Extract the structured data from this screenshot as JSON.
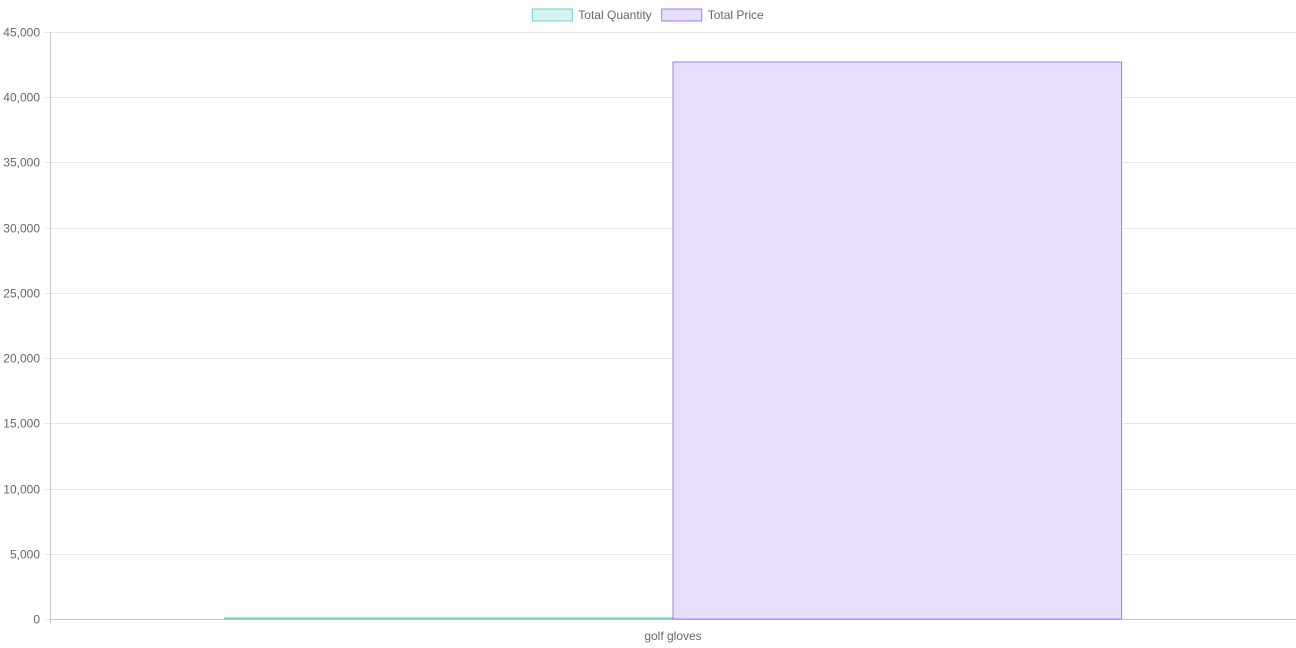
{
  "chart_data": {
    "type": "bar",
    "categories": [
      "golf gloves"
    ],
    "series": [
      {
        "name": "Total Quantity",
        "values": [
          75
        ],
        "fill": "#d6f3f1",
        "stroke": "#6fcfc8"
      },
      {
        "name": "Total Price",
        "values": [
          42700
        ],
        "fill": "#e8dfff",
        "stroke": "#a07ce6"
      }
    ],
    "ylim": [
      0,
      45000
    ],
    "yticks": [
      0,
      5000,
      10000,
      15000,
      20000,
      25000,
      30000,
      35000,
      40000,
      45000
    ],
    "ytick_labels": [
      "0",
      "5,000",
      "10,000",
      "15,000",
      "20,000",
      "25,000",
      "30,000",
      "35,000",
      "40,000",
      "45,000"
    ],
    "grid": true,
    "legend_position": "top-center",
    "title": "",
    "xlabel": "",
    "ylabel": ""
  },
  "colors": {
    "grid": "#e6e6e6",
    "axis": "#c8c8c8",
    "text": "#666666"
  }
}
